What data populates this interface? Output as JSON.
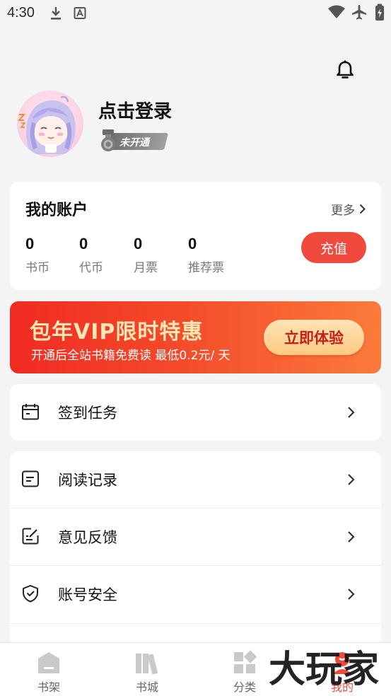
{
  "status_bar": {
    "time": "4:30"
  },
  "profile": {
    "login_text": "点击登录",
    "vip_status": "未开通"
  },
  "account": {
    "title": "我的账户",
    "more": "更多",
    "stats": [
      {
        "value": "0",
        "label": "书币"
      },
      {
        "value": "0",
        "label": "代币"
      },
      {
        "value": "0",
        "label": "月票"
      },
      {
        "value": "0",
        "label": "推荐票"
      }
    ],
    "recharge": "充值"
  },
  "vip_banner": {
    "title": "包年VIP限时特惠",
    "subtitle": "开通后全站书籍免费读 最低0.2元/ 天",
    "cta": "立即体验"
  },
  "menu": {
    "checkin": "签到任务",
    "history": "阅读记录",
    "feedback": "意见反馈",
    "security": "账号安全"
  },
  "bottom_nav": [
    {
      "label": "书架",
      "icon": "bookshelf-icon"
    },
    {
      "label": "书城",
      "icon": "bookstore-icon"
    },
    {
      "label": "分类",
      "icon": "category-icon"
    },
    {
      "label": "我的",
      "icon": "profile-icon"
    }
  ],
  "watermark": "大玩家",
  "colors": {
    "accent": "#f04a3e",
    "vip_gold": "#ffe7b5",
    "background": "#f4f4f4"
  }
}
